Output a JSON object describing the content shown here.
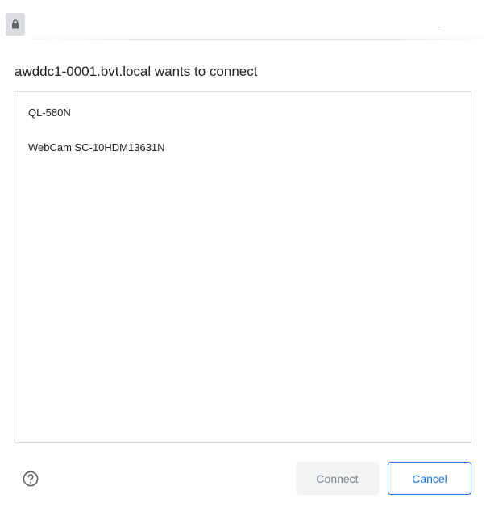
{
  "address_bar": {
    "lock_icon": "lock-icon"
  },
  "dialog": {
    "title": "awddc1-0001.bvt.local wants to connect",
    "devices": [
      {
        "label": "QL-580N"
      },
      {
        "label": "WebCam SC-10HDM13631N"
      }
    ],
    "help_icon": "help-circle-icon",
    "connect_label": "Connect",
    "cancel_label": "Cancel"
  },
  "colors": {
    "accent": "#1a73e8",
    "disabled_bg": "#f1f3f4",
    "disabled_text": "#80868b",
    "border": "#dadce0",
    "text": "#202124"
  }
}
